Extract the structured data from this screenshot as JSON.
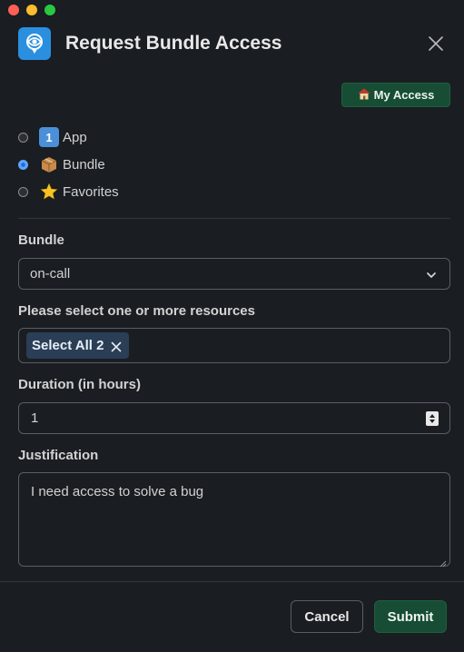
{
  "window": {
    "title": "Request Bundle Access"
  },
  "header": {
    "title": "Request Bundle Access"
  },
  "my_access_button": {
    "label": "My Access",
    "icon": "house-emoji"
  },
  "type_options": [
    {
      "label": "App",
      "icon": "keycap-one-emoji",
      "selected": false
    },
    {
      "label": "Bundle",
      "icon": "package-emoji",
      "selected": true
    },
    {
      "label": "Favorites",
      "icon": "star-emoji",
      "selected": false
    }
  ],
  "bundle": {
    "label": "Bundle",
    "value": "on-call"
  },
  "resources": {
    "label": "Please select one or more resources",
    "chips": [
      {
        "label": "Select All 2"
      }
    ]
  },
  "duration": {
    "label": "Duration (in hours)",
    "value": "1"
  },
  "justification": {
    "label": "Justification",
    "value": "I need access to solve a bug"
  },
  "footer": {
    "cancel_label": "Cancel",
    "submit_label": "Submit"
  },
  "colors": {
    "primary": "#174d34",
    "background": "#1a1d21",
    "chip": "#2a3e56",
    "logo": "#2b8fe0"
  }
}
